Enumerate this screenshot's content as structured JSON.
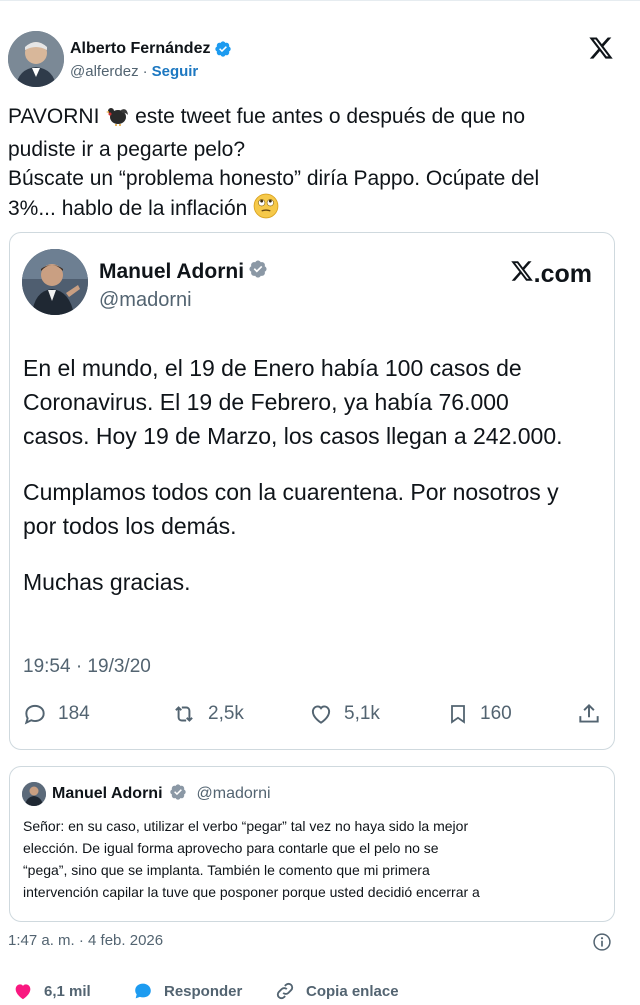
{
  "post": {
    "author_name": "Alberto Fernández",
    "author_handle": "@alferdez",
    "separator": "·",
    "follow_label": "Seguir",
    "text_lines": [
      "PAVORNI ",
      " este tweet fue antes o después de que no",
      "pudiste ir a pegarte pelo?",
      "Búscate un “problema honesto” diría Pappo. Ocúpate del",
      "3%... hablo de la inflación "
    ],
    "timestamp": "1:47 a. m. · 4 feb. 2026",
    "likes": "6,1 mil",
    "reply_label": "Responder",
    "copy_link_label": "Copia enlace"
  },
  "quoted": {
    "author_name": "Manuel Adorni",
    "author_handle": "@madorni",
    "source": ".com",
    "body_lines": [
      "En el mundo, el 19 de Enero había 100 casos de",
      "Coronavirus. El 19 de Febrero, ya había 76.000",
      "casos. Hoy 19 de Marzo, los casos llegan a 242.000.",
      "Cumplamos todos con la cuarentena. Por nosotros y",
      "por todos los demás.",
      "Muchas gracias."
    ],
    "time": "19:54 · 19/3/20",
    "replies": "184",
    "retweets": "2,5k",
    "likes": "5,1k",
    "bookmarks": "160"
  },
  "reply": {
    "author_name": "Manuel Adorni",
    "author_handle": "@madorni",
    "body_lines": [
      "Señor: en su caso, utilizar el verbo “pegar” tal vez no haya sido la mejor",
      "elección. De igual forma aprovecho para contarle que el pelo no se",
      "“pega”, sino que se implanta. También le comento que mi primera",
      "intervención capilar la tuve que posponer porque usted decidió encerrar a"
    ]
  },
  "colors": {
    "verified": "#1d9bf0",
    "follow": "#1d78c1",
    "like": "#f91880",
    "muted": "#536471"
  }
}
